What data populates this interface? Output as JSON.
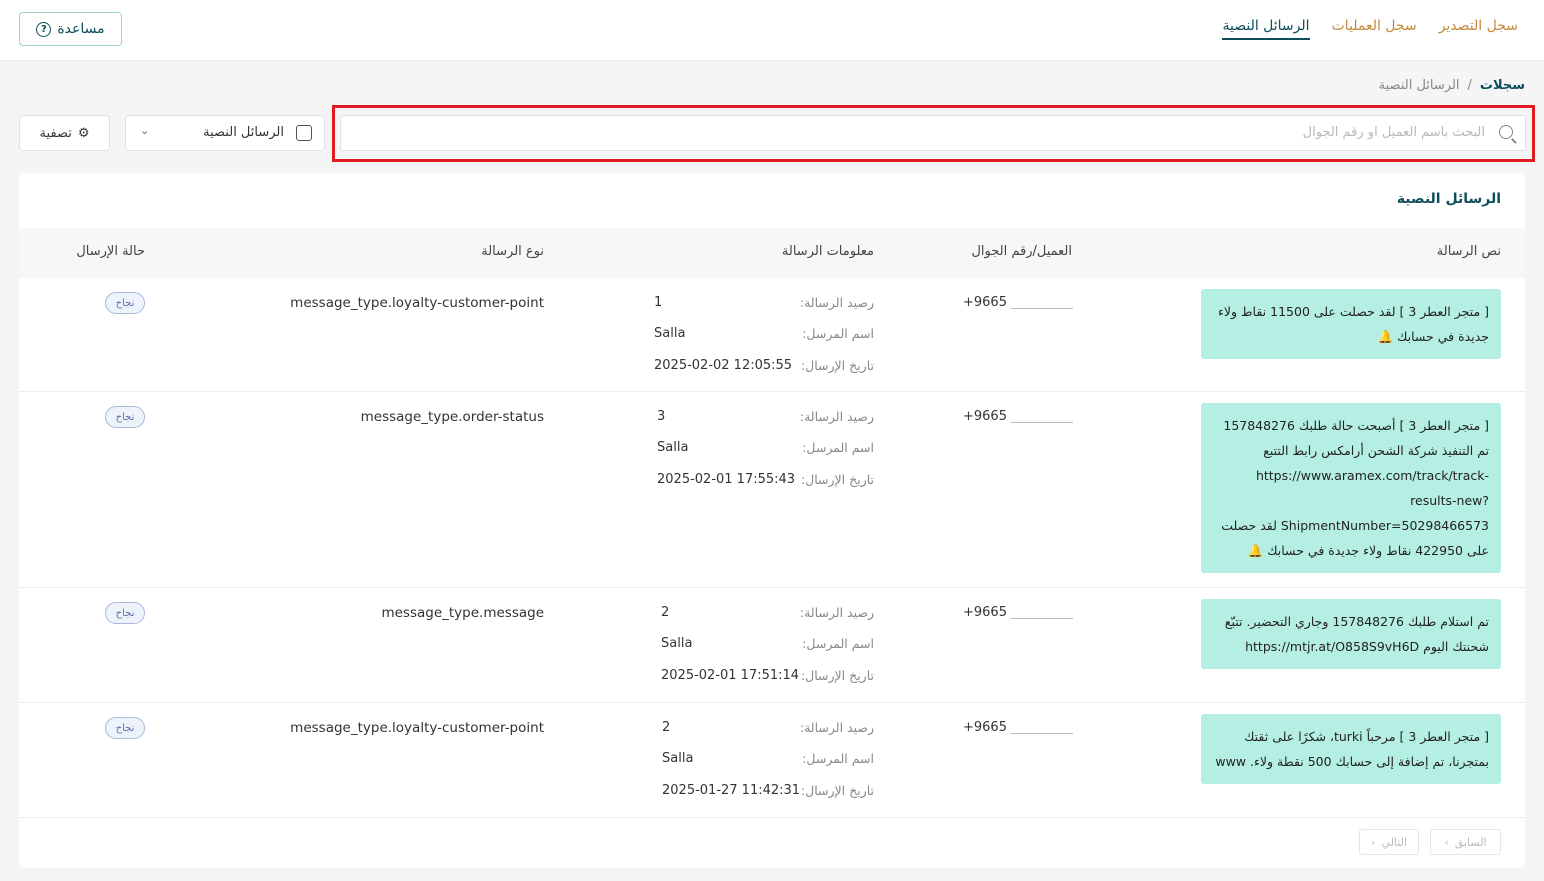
{
  "header": {
    "help_label": "مساعدة",
    "help_icon": "question-circle-icon",
    "tabs": [
      {
        "label": "الرسائل النصية",
        "active": true
      },
      {
        "label": "سجل العمليات",
        "active": false
      },
      {
        "label": "سجل التصدير",
        "active": false
      }
    ]
  },
  "breadcrumb": {
    "root": "سجلات",
    "separator": "/",
    "current": "الرسائل النصية"
  },
  "toolbar": {
    "search_placeholder": "البحث باسم العميل او رقم الجوال",
    "search_value": "",
    "select_value": "الرسائل النصية",
    "filter_label": "تصفية"
  },
  "table": {
    "title": "الرسائل النصية",
    "headers": {
      "text": "نص الرسالة",
      "customer": "العميل/رقم الجوال",
      "info": "معلومات الرسالة",
      "type": "نوع الرسالة",
      "status": "حالة الإرسال"
    },
    "info_labels": {
      "balance": "رصيد الرسالة:",
      "sender": "اسم المرسل:",
      "date": "تاريخ الإرسال:"
    },
    "rows": [
      {
        "text": "[ متجر العطر 3 ] لقد حصلت على 11500 نقاط ولاء جديدة في حسابك 🔔",
        "phone": "+9665",
        "balance": "1",
        "sender": "Salla",
        "date": "2025-02-02 12:05:55",
        "type": "message_type.loyalty-customer-point",
        "status": "نجاح"
      },
      {
        "text": "[ متجر العطر 3 ] أصبحت حالة طلبك 157848276 تم التنفيذ شركة الشحن أرامكس رابط التتبع https://www.aramex.com/track/track-results-new?ShipmentNumber=50298466573 لقد حصلت على 422950 نقاط ولاء جديدة في حسابك 🔔",
        "phone": "+9665",
        "balance": "3",
        "sender": "Salla",
        "date": "2025-02-01 17:55:43",
        "type": "message_type.order-status",
        "status": "نجاح"
      },
      {
        "text": "تم استلام طلبك 157848276 وجاري التحضير. تتبّع شحنتك اليوم https://mtjr.at/O858S9vH6D",
        "phone": "+9665",
        "balance": "2",
        "sender": "Salla",
        "date": "2025-02-01 17:51:14",
        "type": "message_type.message",
        "status": "نجاح"
      },
      {
        "text": "[ متجر العطر 3 ] مرحباً turki، شكرًا على ثقتك بمتجرنا، تم إضافة إلى حسابك 500 نقطة ولاء. www",
        "phone": "+9665",
        "balance": "2",
        "sender": "Salla",
        "date": "2025-01-27 11:42:31",
        "type": "message_type.loyalty-customer-point",
        "status": "نجاح"
      }
    ]
  },
  "pagination": {
    "prev_label": "السابق",
    "next_label": "التالي"
  },
  "colors": {
    "accent": "#0e4e5a",
    "tab_inactive": "#c48a3a",
    "bubble": "#b5efe3",
    "highlight": "#e01b24"
  }
}
